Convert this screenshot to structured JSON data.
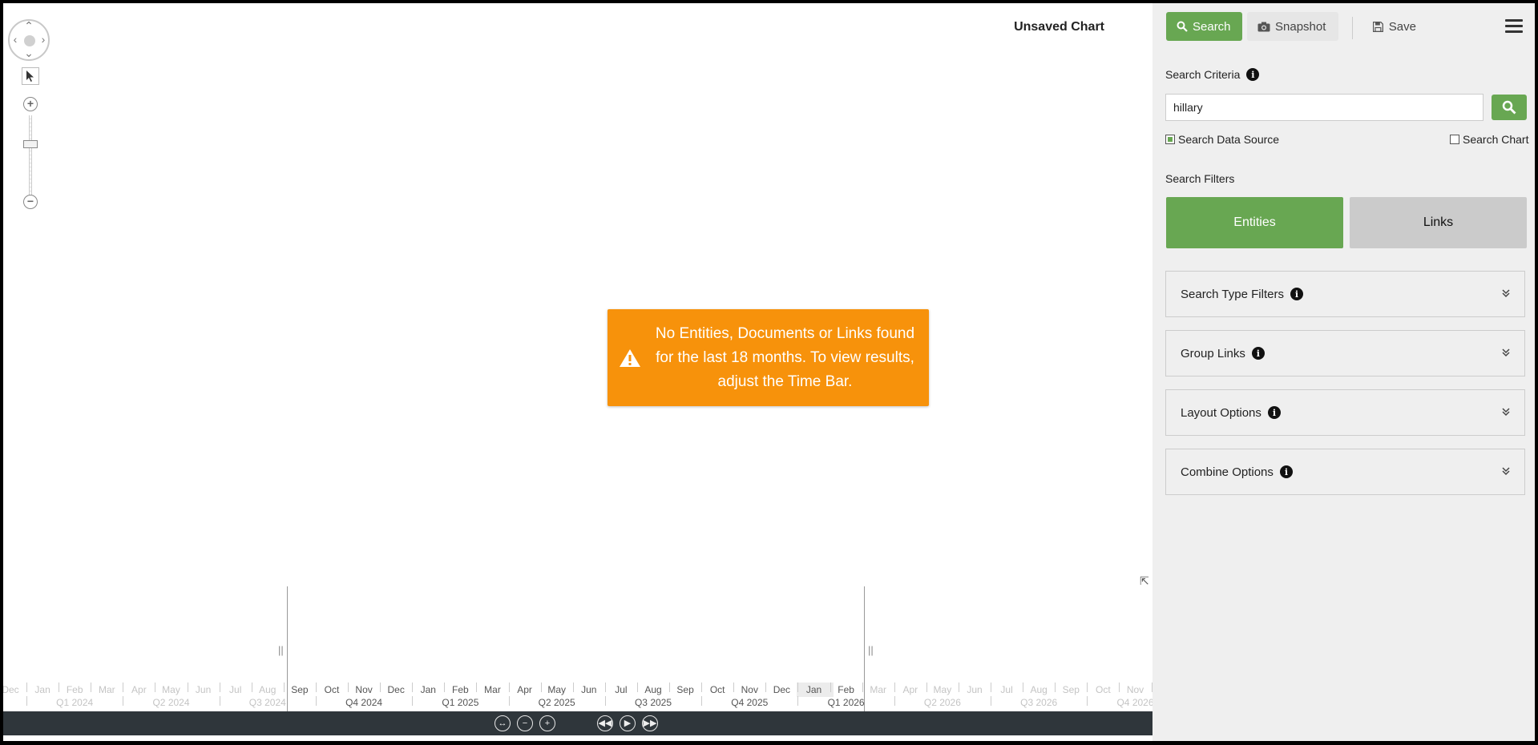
{
  "chart": {
    "title": "Unsaved Chart"
  },
  "toast": {
    "message": "No Entities, Documents or Links found for the last 18 months. To view results, adjust the Time Bar."
  },
  "timebar": {
    "months": [
      "Dec",
      "Jan",
      "Feb",
      "Mar",
      "Apr",
      "May",
      "Jun",
      "Jul",
      "Aug",
      "Sep",
      "Oct",
      "Nov",
      "Dec",
      "Jan",
      "Feb",
      "Mar",
      "Apr",
      "May",
      "Jun",
      "Jul",
      "Aug",
      "Sep",
      "Oct",
      "Nov",
      "Dec",
      "Jan",
      "Feb",
      "Mar",
      "Apr",
      "May",
      "Jun",
      "Jul",
      "Aug",
      "Sep",
      "Oct",
      "Nov"
    ],
    "quarters": [
      "Q1 2024",
      "Q2 2024",
      "Q3 2024",
      "Q4 2024",
      "Q1 2025",
      "Q2 2025",
      "Q3 2025",
      "Q4 2025",
      "Q1 2026",
      "Q2 2026",
      "Q3 2026",
      "Q4 2026"
    ],
    "current_month": "Jan"
  },
  "toolbar": {
    "search_label": "Search",
    "snapshot_label": "Snapshot",
    "save_label": "Save"
  },
  "search": {
    "criteria_label": "Search Criteria",
    "query": "hillary",
    "data_source_label": "Search Data Source",
    "data_source_checked": true,
    "chart_label": "Search Chart",
    "chart_checked": false,
    "filters_label": "Search Filters"
  },
  "tabs": {
    "entities": "Entities",
    "links": "Links",
    "active": "entities"
  },
  "accordions": [
    {
      "label": "Search Type Filters"
    },
    {
      "label": "Group Links"
    },
    {
      "label": "Layout Options"
    },
    {
      "label": "Combine Options"
    }
  ],
  "colors": {
    "accent_green": "#68a752",
    "warning_orange": "#f7920b",
    "control_bar": "#2f363b"
  }
}
